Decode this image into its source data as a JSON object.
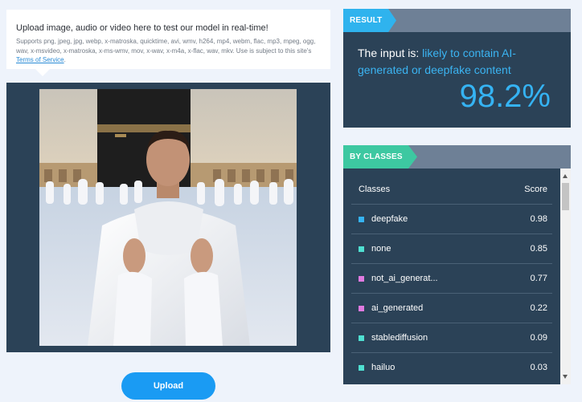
{
  "upload": {
    "title": "Upload image, audio or video here to test our model in real-time!",
    "supported_prefix": "Supports png, jpeg, jpg, webp, x-matroska, quicktime, avi, wmv, h264, mp4, webm, flac, mp3, mpeg, ogg, wav, x-msvideo, x-matroska, x-ms-wmv, mov, x-wav, x-m4a, x-flac, wav, mkv. Use is subject to this site's ",
    "tos_label": "Terms of Service",
    "tos_suffix": ".",
    "button_label": "Upload"
  },
  "result": {
    "tag": "RESULT",
    "prefix": "The input is: ",
    "verdict": "likely to contain AI-generated or deepfake content",
    "percent": "98.2%",
    "accent": "#3bb4f2"
  },
  "classes": {
    "tag": "BY CLASSES",
    "col_class": "Classes",
    "col_score": "Score",
    "rows": [
      {
        "name": "deepfake",
        "score": "0.98",
        "color": "#35b3f3"
      },
      {
        "name": "none",
        "score": "0.85",
        "color": "#4fe0d1"
      },
      {
        "name": "not_ai_generat...",
        "score": "0.77",
        "color": "#e07ae0"
      },
      {
        "name": "ai_generated",
        "score": "0.22",
        "color": "#e07ae0"
      },
      {
        "name": "stablediffusion",
        "score": "0.09",
        "color": "#4fe0d1"
      },
      {
        "name": "hailuo",
        "score": "0.03",
        "color": "#4fe0d1"
      }
    ]
  }
}
